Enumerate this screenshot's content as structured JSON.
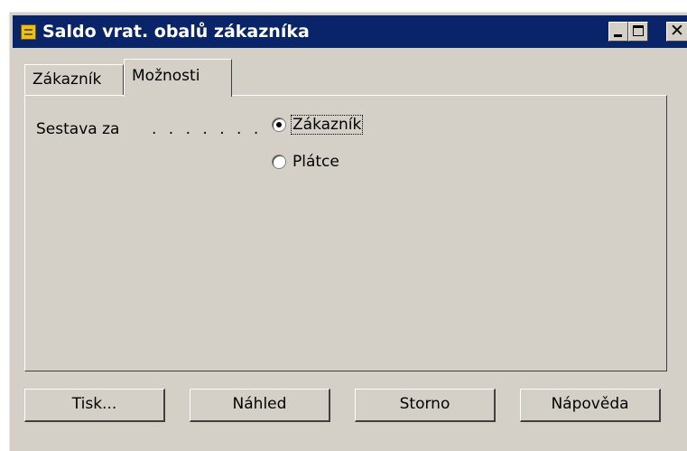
{
  "window": {
    "title": "Saldo vrat. obalů zákazníka"
  },
  "tabs": [
    {
      "label": "Zákazník",
      "active": false
    },
    {
      "label": "Možnosti",
      "active": true
    }
  ],
  "options": {
    "report_for_label": "Sestava za",
    "dots": ". . . . . . .",
    "radios": [
      {
        "label": "Zákazník",
        "checked": true
      },
      {
        "label": "Plátce",
        "checked": false
      }
    ]
  },
  "buttons": {
    "print": "Tisk...",
    "preview": "Náhled",
    "cancel": "Storno",
    "help": "Nápověda"
  }
}
